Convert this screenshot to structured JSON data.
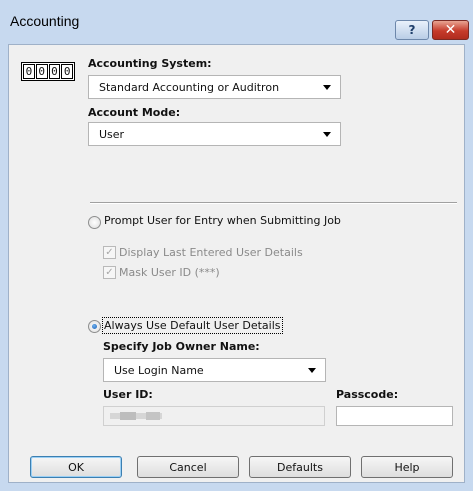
{
  "window": {
    "title": "Accounting",
    "help_glyph": "?",
    "close_glyph": "✕"
  },
  "counter_icon": {
    "digits": [
      "0",
      "0",
      "0",
      "0"
    ]
  },
  "accounting_system": {
    "label": "Accounting System:",
    "value": "Standard Accounting or Auditron"
  },
  "account_mode": {
    "label": "Account Mode:",
    "value": "User"
  },
  "prompt_option": {
    "label": "Prompt User for Entry when Submitting Job",
    "selected": false,
    "display_last": {
      "label": "Display Last Entered User Details",
      "checked": true
    },
    "mask_user_id": {
      "label": "Mask User ID (***)",
      "checked": true
    }
  },
  "default_option": {
    "label": "Always Use Default User Details",
    "selected": true
  },
  "job_owner": {
    "label": "Specify Job Owner Name:",
    "value": "Use Login Name"
  },
  "user_id": {
    "label": "User ID:",
    "value": ""
  },
  "passcode": {
    "label": "Passcode:",
    "value": ""
  },
  "buttons": {
    "ok": "OK",
    "cancel": "Cancel",
    "defaults": "Defaults",
    "help": "Help"
  },
  "check_glyph": "✓"
}
